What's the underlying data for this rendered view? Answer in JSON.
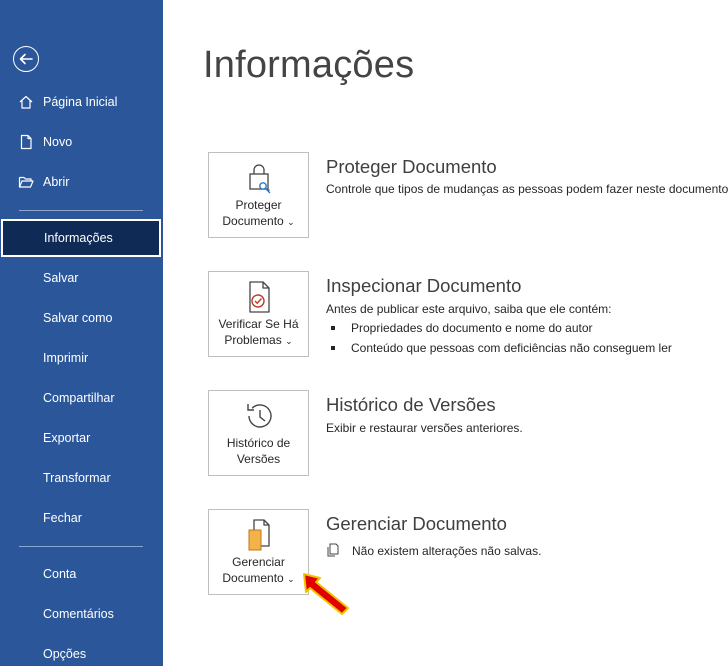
{
  "sidebar": {
    "back_icon": "back-arrow-icon",
    "items": [
      {
        "label": "Página Inicial",
        "icon": "home-icon"
      },
      {
        "label": "Novo",
        "icon": "new-document-icon"
      },
      {
        "label": "Abrir",
        "icon": "open-folder-icon"
      },
      {
        "label": "Informações"
      },
      {
        "label": "Salvar"
      },
      {
        "label": "Salvar como"
      },
      {
        "label": "Imprimir"
      },
      {
        "label": "Compartilhar"
      },
      {
        "label": "Exportar"
      },
      {
        "label": "Transformar"
      },
      {
        "label": "Fechar"
      },
      {
        "label": "Conta"
      },
      {
        "label": "Comentários"
      },
      {
        "label": "Opções"
      }
    ],
    "active_item": "Informações",
    "background_color": "#2b579a",
    "active_color": "#0e2a55"
  },
  "main": {
    "title": "Informações",
    "sections": [
      {
        "tile_line1": "Proteger",
        "tile_line2": "Documento",
        "tile_icon": "lock-key-icon",
        "title": "Proteger Documento",
        "description": "Controle que tipos de mudanças as pessoas podem fazer neste documento."
      },
      {
        "tile_line1": "Verificar Se Há",
        "tile_line2": "Problemas",
        "tile_icon": "document-check-icon",
        "title": "Inspecionar Documento",
        "description": "Antes de publicar este arquivo, saiba que ele contém:",
        "bullets": [
          "Propriedades do documento e nome do autor",
          "Conteúdo que pessoas com deficiências não conseguem ler"
        ]
      },
      {
        "tile_line1": "Histórico de",
        "tile_line2": "Versões",
        "tile_icon": "history-clock-icon",
        "title": "Histórico de Versões",
        "description": "Exibir e restaurar versões anteriores."
      },
      {
        "tile_line1": "Gerenciar",
        "tile_line2": "Documento",
        "tile_icon": "manage-document-icon",
        "title": "Gerenciar Documento",
        "description": "Não existem alterações não salvas.",
        "description_icon": "document-copy-icon"
      }
    ],
    "annotation_arrow_color": "#e00000"
  }
}
